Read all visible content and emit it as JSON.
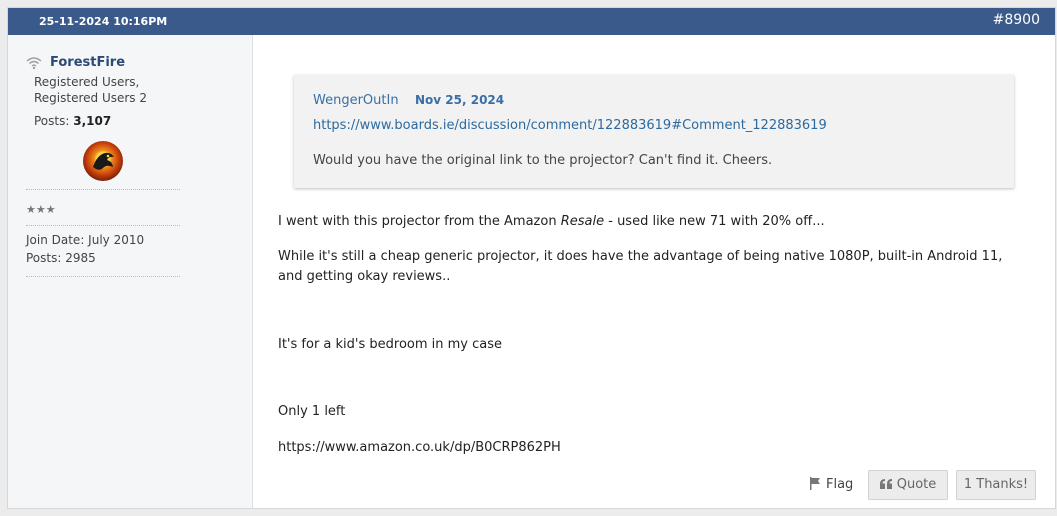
{
  "header": {
    "date": "25-11-2024 10:16PM",
    "post_number": "#8900"
  },
  "sidebar": {
    "username": "ForestFire",
    "usergroup_line1": "Registered Users,",
    "usergroup_line2": "Registered Users 2",
    "posts_label": "Posts:",
    "posts_value": "3,107",
    "stars": "★★★",
    "join_date": "Join Date: July 2010",
    "post_count": "Posts: 2985"
  },
  "quote": {
    "author": "WengerOutIn",
    "date": "Nov 25, 2024",
    "link": "https://www.boards.ie/discussion/comment/122883619#Comment_122883619",
    "text": "Would you have the original link to the projector? Can't find it. Cheers."
  },
  "body": {
    "line1_pre": "I went with this projector from the Amazon ",
    "line1_em": "Resale",
    "line1_post": " - used like new 71 with 20% off...",
    "paragraph2_line1": "While it's still a cheap generic projector, it does have the advantage of being native 1080P, built-in Android 11,",
    "paragraph2_line2": "and getting okay reviews..",
    "paragraph3": "It's for a kid's bedroom in my case",
    "paragraph4": "Only 1 left",
    "paragraph5": "https://www.amazon.co.uk/dp/B0CRP862PH"
  },
  "actions": {
    "flag_label": "Flag",
    "quote_label": "Quote",
    "thanks_label": "1 Thanks!"
  },
  "colors": {
    "header_bg": "#3a5a8c",
    "link": "#3a6ea5",
    "username": "#2b4a78"
  }
}
